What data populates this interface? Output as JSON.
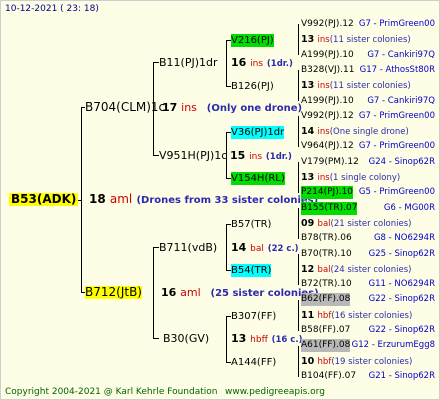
{
  "header": {
    "date": "10-12-2021 ( 23: 18)"
  },
  "footer": {
    "copyright": "Copyright 2004-2021 @ Karl Kehrle Foundation",
    "site": "www.pedigreeapis.org"
  },
  "root": {
    "name": "B53(ADK)",
    "num": "18",
    "kw": "aml",
    "note": "(Drones from 33 sister colonies)"
  },
  "colors": {
    "yellow": "#ffff00",
    "green": "#00dd00",
    "cyan": "#00ffff",
    "gray": "#b8b8b8",
    "red": "#cc0000",
    "navy": "#00008b"
  },
  "gen1": [
    {
      "name": "B704(CLM)1c",
      "num": "17",
      "kw": "ins",
      "note": "(Only one drone)"
    },
    {
      "name": "B712(JtB)",
      "num": "16",
      "kw": "aml",
      "note": "(25 sister colonies)"
    }
  ],
  "gen2": [
    {
      "name": "B11(PJ)1dr",
      "num": "16",
      "kw": "ins",
      "note": "(1dr.)"
    },
    {
      "name": "V951H(PJ)1c",
      "num": "15",
      "kw": "ins",
      "note": "(1dr.)"
    },
    {
      "name": "B711(vdB)",
      "num": "14",
      "kw": "bal",
      "note": "(22 c.)"
    },
    {
      "name": "B30(GV)",
      "num": "13",
      "kw": "hbff",
      "note": "(16 c.)"
    }
  ],
  "gen3": [
    {
      "name": "V216(PJ)"
    },
    {
      "name": "B126(PJ)"
    },
    {
      "name": "V36(PJ)1dr"
    },
    {
      "name": "V154H(RL)"
    },
    {
      "name": "B57(TR)"
    },
    {
      "name": "B54(TR)"
    },
    {
      "name": "B307(FF)"
    },
    {
      "name": "A144(FF)"
    }
  ],
  "gen4": [
    {
      "name": "V992(PJ).12",
      "ref": "G7 - PrimGreen00"
    },
    {
      "num": "13",
      "kw": "ins",
      "note": "(11 sister colonies)"
    },
    {
      "name": "A199(PJ).10",
      "ref": "G7 - Cankiri97Q"
    },
    {
      "name": "B328(VJ).11",
      "ref": "G17 - AthosSt80R"
    },
    {
      "num": "13",
      "kw": "ins",
      "note": "(11 sister colonies)"
    },
    {
      "name": "A199(PJ).10",
      "ref": "G7 - Cankiri97Q"
    },
    {
      "name": "V992(PJ).12",
      "ref": "G7 - PrimGreen00"
    },
    {
      "num": "14",
      "kw": "ins",
      "note": "(One single drone)"
    },
    {
      "name": "V964(PJ).12",
      "ref": "G7 - PrimGreen00"
    },
    {
      "name": "V179(PM).12",
      "ref": "G24 - Sinop62R"
    },
    {
      "num": "13",
      "kw": "ins",
      "note": "(1 single colony)"
    },
    {
      "name": "P214(PJ).10",
      "ref": "G5 - PrimGreen00"
    },
    {
      "name": "B155(TR).07",
      "ref": "G6 - MG00R"
    },
    {
      "num": "09",
      "kw": "bal",
      "note": "(21 sister colonies)"
    },
    {
      "name": "B78(TR).06",
      "ref": "G8 - NO6294R"
    },
    {
      "name": "B70(TR).10",
      "ref": "G25 - Sinop62R"
    },
    {
      "num": "12",
      "kw": "bal",
      "note": "(24 sister colonies)"
    },
    {
      "name": "B72(TR).10",
      "ref": "G11 - NO6294R"
    },
    {
      "name": "B62(FF).08",
      "ref": "G22 - Sinop62R"
    },
    {
      "num": "11",
      "kw": "hbf",
      "note": "(16 sister colonies)"
    },
    {
      "name": "B58(FF).07",
      "ref": "G22 - Sinop62R"
    },
    {
      "name": "A61(FF).08",
      "ref": "G12 - ErzurumEgg8"
    },
    {
      "num": "10",
      "kw": "hbf",
      "note": "(19 sister colonies)"
    },
    {
      "name": "B104(FF).07",
      "ref": "G21 - Sinop62R"
    }
  ]
}
